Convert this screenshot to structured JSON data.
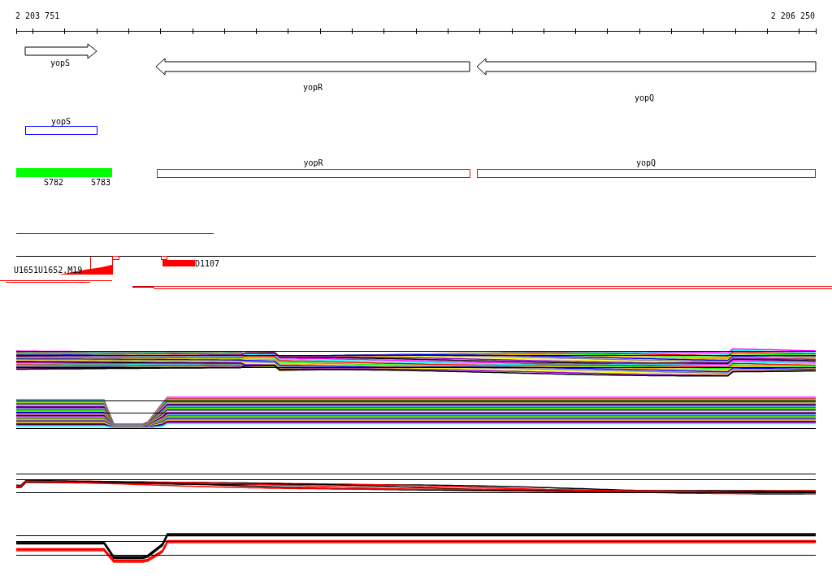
{
  "ruler": {
    "start_label": "2 203 751",
    "end_label": "2 206 250"
  },
  "gene_arrows": [
    {
      "label": "yopS",
      "reverse": false
    },
    {
      "label": "yopR",
      "reverse": true
    },
    {
      "label": "yopQ",
      "reverse": true
    }
  ],
  "gene_boxes": [
    {
      "label": "yopS",
      "color": "#0000ff"
    },
    {
      "label": "yopR",
      "color": "#ff0000"
    },
    {
      "label": "yopQ",
      "color": "#ff0000"
    }
  ],
  "region_labels": [
    "S782",
    "S783"
  ],
  "read_labels": [
    "U1651U1652.M19",
    "D1107"
  ]
}
